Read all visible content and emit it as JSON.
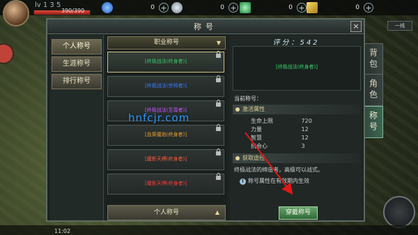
{
  "hud": {
    "level": "lv 1 3 5",
    "hp_text": "390/390",
    "resources": [
      {
        "icon": "blue-gem-icon",
        "value": "0",
        "color": "#3c8cf0"
      },
      {
        "icon": "silver-coin-icon",
        "value": "0",
        "color": "#aab7c2"
      },
      {
        "icon": "green-crystal-icon",
        "value": "0",
        "color": "#49c46e"
      },
      {
        "icon": "gold-ticket-icon",
        "value": "0",
        "color": "#e0b640"
      }
    ],
    "map_label": "一线",
    "time": "11:02"
  },
  "side_tabs": [
    {
      "label": "背包",
      "active": false
    },
    {
      "label": "角色",
      "active": false
    },
    {
      "label": "称号",
      "active": true
    }
  ],
  "window": {
    "title": "称号",
    "close": "×",
    "categories": [
      {
        "label": "个人称号",
        "active": true
      },
      {
        "label": "生涯称号",
        "active": false
      },
      {
        "label": "排行称号",
        "active": false
      }
    ],
    "filter_label": "职业称号",
    "cards": [
      {
        "name": "[终极战法(终身者)]",
        "color": "#38c96a",
        "selected": true
      },
      {
        "name": "[终极战法(宗师者)]",
        "color": "#3d7bff",
        "selected": false
      },
      {
        "name": "[终极战法(至尊者)]",
        "color": "#c355ff",
        "selected": false
      },
      {
        "name": "[血祭魔焰(终身者)]",
        "color": "#e8a033",
        "selected": false
      },
      {
        "name": "[魔影天缚(终身者)]",
        "color": "#ff5a3a",
        "selected": false
      },
      {
        "name": "[魔影天缚(终身者)]",
        "color": "#ff3b3b",
        "selected": false
      }
    ],
    "footer_label": "个人称号",
    "score": "评分：542",
    "preview_name": "[终极战法(终身者)]",
    "current_label": "当前称号：",
    "attr_section": "激活属性",
    "stats": [
      {
        "name": "生命上限",
        "value": "720"
      },
      {
        "name": "力量",
        "value": "12"
      },
      {
        "name": "智慧",
        "value": "12"
      },
      {
        "name": "抗会心",
        "value": "3"
      }
    ],
    "obtain_section": "获取途径",
    "obtain_text": "终极战法的缔造者，高级可以战式。",
    "info_text": "称号属性在有效期内生效",
    "wear_button": "穿戴称号"
  },
  "watermark": "hnfcjr.com"
}
